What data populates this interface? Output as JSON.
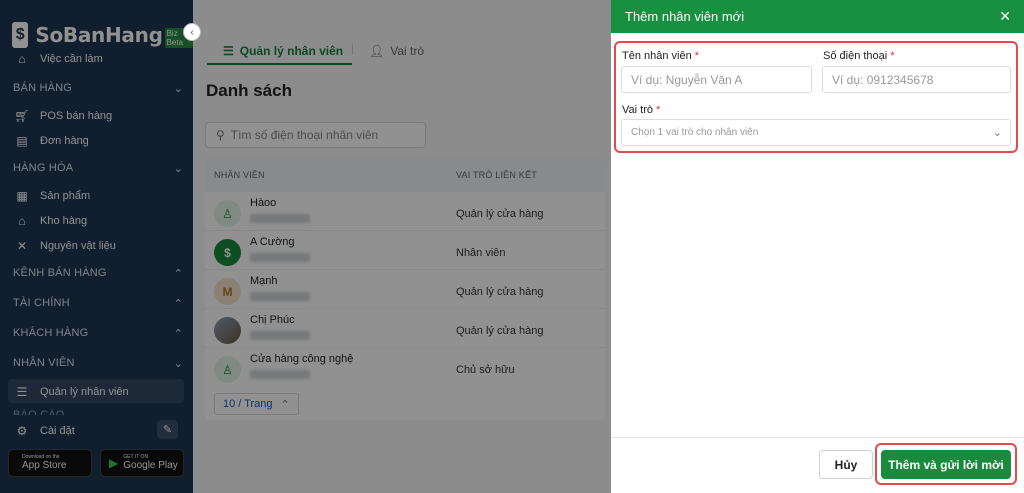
{
  "app": {
    "brand": "SoBanHang",
    "badge": "Biz Beta",
    "logo_glyph": "$"
  },
  "sidebar": {
    "top_item": "Việc cần làm",
    "sections": {
      "ban_hang": "BÁN HÀNG",
      "hang_hoa": "HÀNG HÓA",
      "kenh_ban_hang": "KÊNH BÁN HÀNG",
      "tai_chinh": "TÀI CHÍNH",
      "khach_hang": "KHÁCH HÀNG",
      "nhan_vien": "NHÂN VIÊN",
      "bao_cao": "BÁO CÁO"
    },
    "items": {
      "pos": "POS bán hàng",
      "don_hang": "Đơn hàng",
      "san_pham": "Sản phẩm",
      "kho_hang": "Kho hàng",
      "nguyen_vat_lieu": "Nguyên vật liệu",
      "quan_ly_nhan_vien": "Quản lý nhân viên"
    },
    "settings": "Cài đặt",
    "app_store": {
      "small": "Download on the",
      "big": "App Store"
    },
    "google_play": {
      "small": "GET IT ON",
      "big": "Google Play"
    }
  },
  "main": {
    "tabs": [
      {
        "label": "Quản lý nhân viên"
      },
      {
        "label": "Vai trò"
      }
    ],
    "title": "Danh sách",
    "search_placeholder": "Tìm số điện thoại nhân viên",
    "columns": {
      "employee": "NHÂN VIÊN",
      "role": "VAI TRÒ LIÊN KẾT"
    },
    "rows": [
      {
        "name": "Hàoo",
        "role": "Quản lý cửa hàng"
      },
      {
        "name": "A Cường",
        "role": "Nhân viên"
      },
      {
        "name": "Mạnh",
        "role": "Quản lý cửa hàng"
      },
      {
        "name": "Chị Phúc",
        "role": "Quản lý cửa hàng"
      },
      {
        "name": "Cửa hàng công nghệ",
        "role": "Chủ sở hữu"
      }
    ],
    "page_size": "10 / Trang"
  },
  "panel": {
    "title": "Thêm nhân viên mới",
    "name_label": "Tên nhân viên",
    "name_placeholder": "Ví dụ: Nguyễn Văn A",
    "phone_label": "Số điện thoại",
    "phone_placeholder": "Ví dụ: 0912345678",
    "role_label": "Vai trò",
    "role_placeholder": "Chọn 1 vai trò cho nhân viên",
    "required_mark": "*",
    "cancel": "Hủy",
    "submit": "Thêm và gửi lời mời"
  },
  "colors": {
    "sidebar": "#1e3652",
    "accent": "#17913f",
    "highlight": "#e34c4c"
  }
}
